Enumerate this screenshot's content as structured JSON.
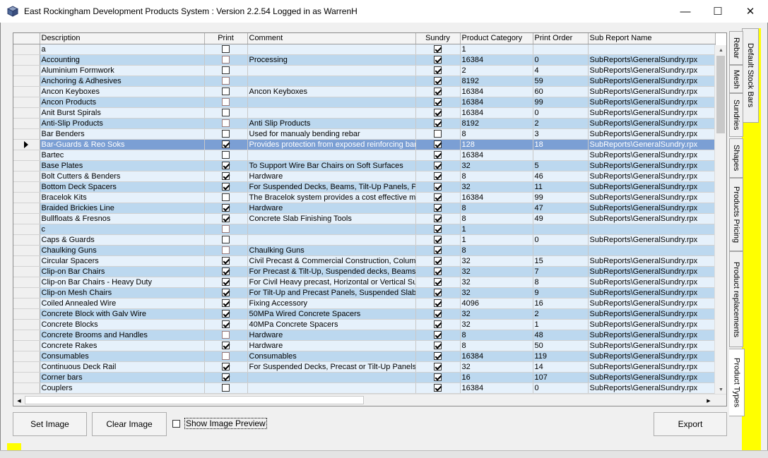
{
  "window": {
    "title": "East Rockingham Development Products System : Version 2.2.54 Logged in as WarrenH",
    "minimize": "—",
    "maximize": "☐",
    "close": "✕"
  },
  "grid": {
    "columns": [
      "Description",
      "Print",
      "Comment",
      "Sundry",
      "Product Category",
      "Print Order",
      "Sub Report Name"
    ],
    "selected_row_index": 9,
    "rows": [
      {
        "description": "a",
        "print": false,
        "comment": "",
        "sundry": true,
        "category": "1",
        "order": "",
        "sub": ""
      },
      {
        "description": "Accounting",
        "print": false,
        "comment": "Processing",
        "sundry": true,
        "category": "16384",
        "order": "0",
        "sub": "SubReports\\GeneralSundry.rpx"
      },
      {
        "description": "Aluminium Formwork",
        "print": false,
        "comment": "",
        "sundry": true,
        "category": "2",
        "order": "4",
        "sub": "SubReports\\GeneralSundry.rpx"
      },
      {
        "description": "Anchoring & Adhesives",
        "print": false,
        "comment": "",
        "sundry": true,
        "category": "8192",
        "order": "59",
        "sub": "SubReports\\GeneralSundry.rpx"
      },
      {
        "description": "Ancon Keyboxes",
        "print": false,
        "comment": "Ancon Keyboxes",
        "sundry": true,
        "category": "16384",
        "order": "60",
        "sub": "SubReports\\GeneralSundry.rpx"
      },
      {
        "description": "Ancon Products",
        "print": false,
        "comment": "",
        "sundry": true,
        "category": "16384",
        "order": "99",
        "sub": "SubReports\\GeneralSundry.rpx"
      },
      {
        "description": "Anit Burst Spirals",
        "print": false,
        "comment": "",
        "sundry": true,
        "category": "16384",
        "order": "0",
        "sub": "SubReports\\GeneralSundry.rpx"
      },
      {
        "description": "Anti-Slip Products",
        "print": false,
        "comment": "Anti Slip Products",
        "sundry": true,
        "category": "8192",
        "order": "2",
        "sub": "SubReports\\GeneralSundry.rpx"
      },
      {
        "description": "Bar Benders",
        "print": false,
        "comment": "Used for manualy bending rebar",
        "sundry": false,
        "category": "8",
        "order": "3",
        "sub": "SubReports\\GeneralSundry.rpx"
      },
      {
        "description": "Bar-Guards & Reo Soks",
        "print": true,
        "comment": "Provides protection from exposed reinforcing bar",
        "sundry": true,
        "category": "128",
        "order": "18",
        "sub": "SubReports\\GeneralSundry.rpx"
      },
      {
        "description": "Bartec",
        "print": false,
        "comment": "",
        "sundry": true,
        "category": "16384",
        "order": "",
        "sub": "SubReports\\GeneralSundry.rpx"
      },
      {
        "description": "Base Plates",
        "print": true,
        "comment": "To Support Wire Bar Chairs on Soft Surfaces",
        "sundry": true,
        "category": "32",
        "order": "5",
        "sub": "SubReports\\GeneralSundry.rpx"
      },
      {
        "description": "Bolt Cutters & Benders",
        "print": true,
        "comment": "Hardware",
        "sundry": true,
        "category": "8",
        "order": "46",
        "sub": "SubReports\\GeneralSundry.rpx"
      },
      {
        "description": "Bottom Deck Spacers",
        "print": true,
        "comment": "For Suspended Decks, Beams, Tilt-Up Panels, Pr",
        "sundry": true,
        "category": "32",
        "order": "11",
        "sub": "SubReports\\GeneralSundry.rpx"
      },
      {
        "description": "Bracelok Kits",
        "print": false,
        "comment": "The Bracelok system provides a cost effective me",
        "sundry": true,
        "category": "16384",
        "order": "99",
        "sub": "SubReports\\GeneralSundry.rpx"
      },
      {
        "description": "Braided Brickies Line",
        "print": true,
        "comment": "Hardware",
        "sundry": true,
        "category": "8",
        "order": "47",
        "sub": "SubReports\\GeneralSundry.rpx"
      },
      {
        "description": "Bullfloats & Fresnos",
        "print": true,
        "comment": "Concrete Slab Finishing Tools",
        "sundry": true,
        "category": "8",
        "order": "49",
        "sub": "SubReports\\GeneralSundry.rpx"
      },
      {
        "description": "c",
        "print": false,
        "comment": "",
        "sundry": true,
        "category": "1",
        "order": "",
        "sub": ""
      },
      {
        "description": "Caps & Guards",
        "print": false,
        "comment": "",
        "sundry": true,
        "category": "1",
        "order": "0",
        "sub": "SubReports\\GeneralSundry.rpx"
      },
      {
        "description": "Chaulking Guns",
        "print": false,
        "comment": "Chaulking Guns",
        "sundry": true,
        "category": "8",
        "order": "",
        "sub": ""
      },
      {
        "description": "Circular Spacers",
        "print": true,
        "comment": "Civil Precast & Commercial Construction, Columns",
        "sundry": true,
        "category": "32",
        "order": "15",
        "sub": "SubReports\\GeneralSundry.rpx"
      },
      {
        "description": "Clip-on Bar Chairs",
        "print": true,
        "comment": "For Precast & Tilt-Up, Suspended decks, Beams,",
        "sundry": true,
        "category": "32",
        "order": "7",
        "sub": "SubReports\\GeneralSundry.rpx"
      },
      {
        "description": "Clip-on Bar Chairs - Heavy Duty",
        "print": true,
        "comment": "For Civil Heavy precast, Horizontal or Vertical Sus",
        "sundry": true,
        "category": "32",
        "order": "8",
        "sub": "SubReports\\GeneralSundry.rpx"
      },
      {
        "description": "Clip-on Mesh Chairs",
        "print": true,
        "comment": "For Tilt-Up and Precast Panels, Suspended Slabs",
        "sundry": true,
        "category": "32",
        "order": "9",
        "sub": "SubReports\\GeneralSundry.rpx"
      },
      {
        "description": "Coiled Annealed Wire",
        "print": true,
        "comment": "Fixing Accessory",
        "sundry": true,
        "category": "4096",
        "order": "16",
        "sub": "SubReports\\GeneralSundry.rpx"
      },
      {
        "description": "Concrete Block with Galv Wire",
        "print": true,
        "comment": "50MPa Wired Concrete Spacers",
        "sundry": true,
        "category": "32",
        "order": "2",
        "sub": "SubReports\\GeneralSundry.rpx"
      },
      {
        "description": "Concrete Blocks",
        "print": true,
        "comment": "40MPa Concrete Spacers",
        "sundry": true,
        "category": "32",
        "order": "1",
        "sub": "SubReports\\GeneralSundry.rpx"
      },
      {
        "description": "Concrete Brooms and Handles",
        "print": false,
        "comment": "Hardware",
        "sundry": true,
        "category": "8",
        "order": "48",
        "sub": "SubReports\\GeneralSundry.rpx"
      },
      {
        "description": "Concrete Rakes",
        "print": true,
        "comment": "Hardware",
        "sundry": true,
        "category": "8",
        "order": "50",
        "sub": "SubReports\\GeneralSundry.rpx"
      },
      {
        "description": "Consumables",
        "print": false,
        "comment": "Consumables",
        "sundry": true,
        "category": "16384",
        "order": "119",
        "sub": "SubReports\\GeneralSundry.rpx"
      },
      {
        "description": "Continuous Deck Rail",
        "print": true,
        "comment": "For Suspended Decks, Precast or Tilt-Up Panels,",
        "sundry": true,
        "category": "32",
        "order": "14",
        "sub": "SubReports\\GeneralSundry.rpx"
      },
      {
        "description": "Corner bars",
        "print": true,
        "comment": "",
        "sundry": true,
        "category": "16",
        "order": "107",
        "sub": "SubReports\\GeneralSundry.rpx"
      },
      {
        "description": "Couplers",
        "print": false,
        "comment": "",
        "sundry": true,
        "category": "16384",
        "order": "0",
        "sub": "SubReports\\GeneralSundry.rpx"
      }
    ]
  },
  "buttons": {
    "set_image": "Set Image",
    "clear_image": "Clear Image",
    "show_preview": "Show Image Preview",
    "export": "Export"
  },
  "tabs": [
    "Default Stock Bars",
    "Rebar",
    "Mesh",
    "Sundries",
    "Shapes",
    "Products Pricing",
    "Product replacements",
    "Product Types"
  ],
  "colors": {
    "row_even": "#e6f1fb",
    "row_odd": "#bcd8ef",
    "row_selected": "#7b9fd4",
    "yellow": "#ffff00"
  }
}
